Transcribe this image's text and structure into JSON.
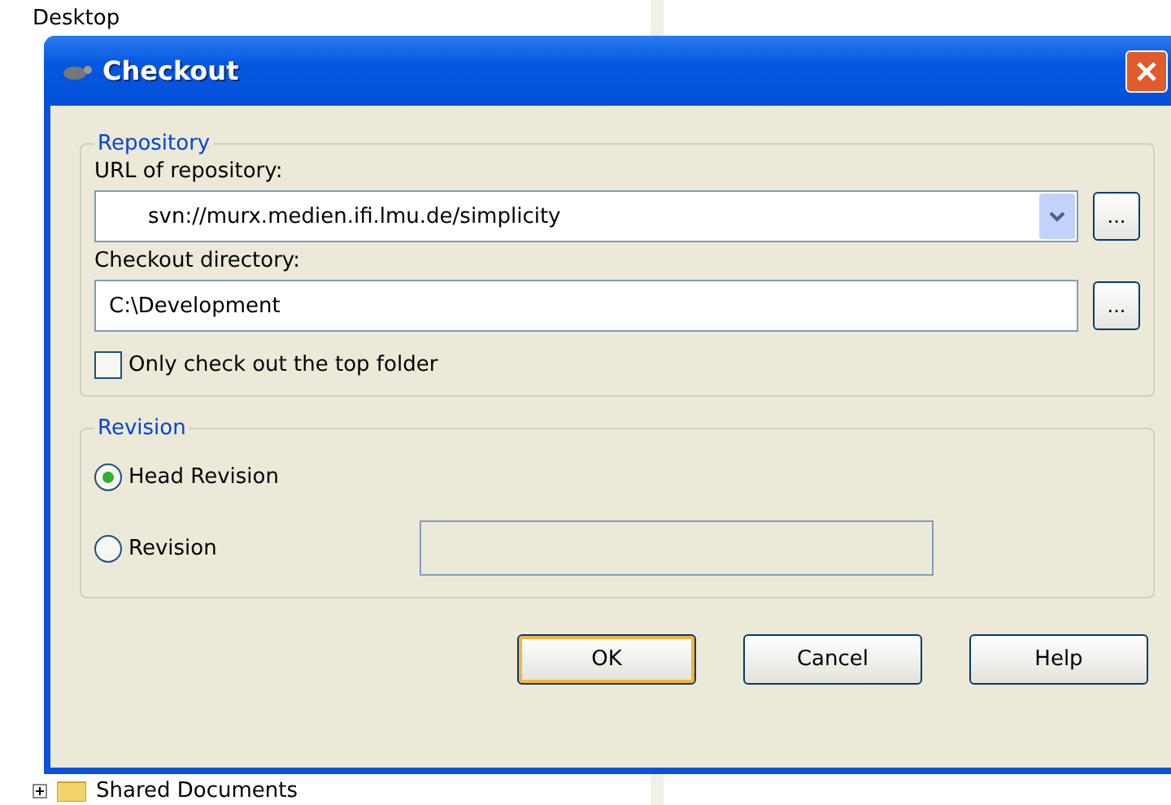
{
  "background": {
    "tree_items": [
      {
        "label": "Desktop",
        "has_expander": false
      },
      {
        "label": "Shared Documents",
        "has_expander": true
      }
    ]
  },
  "dialog": {
    "title": "Checkout",
    "repository": {
      "title": "Repository",
      "url_label": "URL of repository:",
      "url_value": "svn://murx.medien.ifi.lmu.de/simplicity",
      "url_browse": "...",
      "dir_label": "Checkout directory:",
      "dir_value": "C:\\Development",
      "dir_browse": "...",
      "top_folder": {
        "label": "Only check out the top folder",
        "checked": false
      }
    },
    "revision": {
      "title": "Revision",
      "options": [
        {
          "label": "Head Revision",
          "selected": true
        },
        {
          "label": "Revision",
          "selected": false
        }
      ]
    },
    "buttons": [
      {
        "label": "OK",
        "default": true
      },
      {
        "label": "Cancel",
        "default": false
      },
      {
        "label": "Help",
        "default": false
      }
    ]
  }
}
